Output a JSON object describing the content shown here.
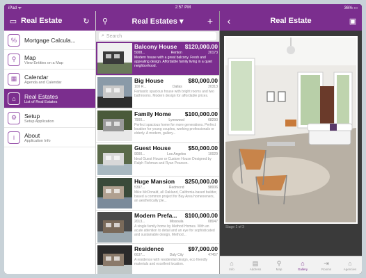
{
  "status": {
    "carrier": "iPad ᯤ",
    "time": "2:57 PM",
    "battery": "36% ▭"
  },
  "menu": {
    "title": "Real Estate",
    "items": [
      {
        "label": "Mortgage Calcula...",
        "sub": "",
        "icon": "calculator-icon",
        "glyph": "%"
      },
      {
        "label": "Map",
        "sub": "View Entities on a Map",
        "icon": "map-pin-icon",
        "glyph": "⚲"
      },
      {
        "label": "Calendar",
        "sub": "Agenda and Calendar",
        "icon": "calendar-icon",
        "glyph": "▦"
      },
      {
        "label": "Real Estates",
        "sub": "List of Real Estates",
        "icon": "building-icon",
        "glyph": "⌂"
      },
      {
        "label": "Setup",
        "sub": "Setup Application",
        "icon": "gear-icon",
        "glyph": "⚙"
      },
      {
        "label": "About",
        "sub": "Application Info",
        "icon": "info-icon",
        "glyph": "i"
      }
    ],
    "active_index": 3
  },
  "list": {
    "title": "Real Estates ▾",
    "add_label": "+",
    "search_placeholder": "Search",
    "rows": [
      {
        "name": "Balcony House",
        "price": "$120,000.00",
        "id": "5008...",
        "city": "Renton",
        "zip": "20173",
        "desc": "Modern house with a great balcony. Fresh and appealing design. Affordable family living in a quiet neighborhood.",
        "colors": [
          "#6b7a5a",
          "#f0f0f0",
          "#3a3a3a"
        ]
      },
      {
        "name": "Big House",
        "price": "$80,000.00",
        "id": "100 R...",
        "city": "Dallas",
        "zip": "20313",
        "desc": "Fantastic spacious house with bright rooms and two bathrooms. Modern design for affordable prices.",
        "colors": [
          "#2d2d2d",
          "#8a9aa8",
          "#c8c8c8"
        ]
      },
      {
        "name": "Family Home",
        "price": "$100,000.00",
        "id": "7900...",
        "city": "Lynnwood",
        "zip": "68290",
        "desc": "Perfect spacious home for more generations. Perfect location for young couples, working professionals or elderly. A modern, gallery...",
        "colors": [
          "#e8e8e8",
          "#4a5a3a",
          "#999"
        ]
      },
      {
        "name": "Guest House",
        "price": "$50,000.00",
        "id": "9000...",
        "city": "Los Angeles",
        "zip": "10029",
        "desc": "Ideal Guest House or Custom House Designed by Ralph Fishman and Ryan Pearson.",
        "colors": [
          "#a8b8c0",
          "#5a6a4a",
          "#d8d8d8"
        ]
      },
      {
        "name": "Huge Mansion",
        "price": "$250,000.00",
        "id": "5397...",
        "city": "Redmond",
        "zip": "98006",
        "desc": "Mike McDonald, all Oakland, California-based builder, based a common project for Bay Area homeowners, an aesthetically ple...",
        "colors": [
          "#7a8a9a",
          "#3a4a3a",
          "#b0a090"
        ]
      },
      {
        "name": "Modern Prefa...",
        "price": "$100,000.00",
        "id": "2013...",
        "city": "Missoula",
        "zip": "08047",
        "desc": "A single family home by Method Homes. With an acute attention to detail and an eye for sophisticated and sustainable design, Method...",
        "colors": [
          "#9aa8b0",
          "#4a4a4a",
          "#7a6a5a"
        ]
      },
      {
        "name": "Residence",
        "price": "$97,000.00",
        "id": "6637...",
        "city": "Daly City",
        "zip": "47457",
        "desc": "A residence with residential design, eco friendly materials and excellent location.",
        "colors": [
          "#c0c8c8",
          "#2a2a2a",
          "#8a7a6a"
        ]
      }
    ],
    "active_index": 0
  },
  "detail": {
    "title": "Real Estate",
    "stage_label": "Stage 1 of 3",
    "tabs": [
      {
        "label": "Info",
        "glyph": "⌂",
        "icon": "home-icon"
      },
      {
        "label": "Address",
        "glyph": "▤",
        "icon": "address-icon"
      },
      {
        "label": "Map",
        "glyph": "⚲",
        "icon": "map-pin-icon"
      },
      {
        "label": "Gallery",
        "glyph": "⌂",
        "icon": "gallery-icon"
      },
      {
        "label": "Rooms",
        "glyph": "⇥",
        "icon": "rooms-icon"
      },
      {
        "label": "Agencies",
        "glyph": "⌂",
        "icon": "agencies-icon"
      }
    ],
    "active_tab": 3
  },
  "colors": {
    "accent": "#7b2e8e"
  }
}
